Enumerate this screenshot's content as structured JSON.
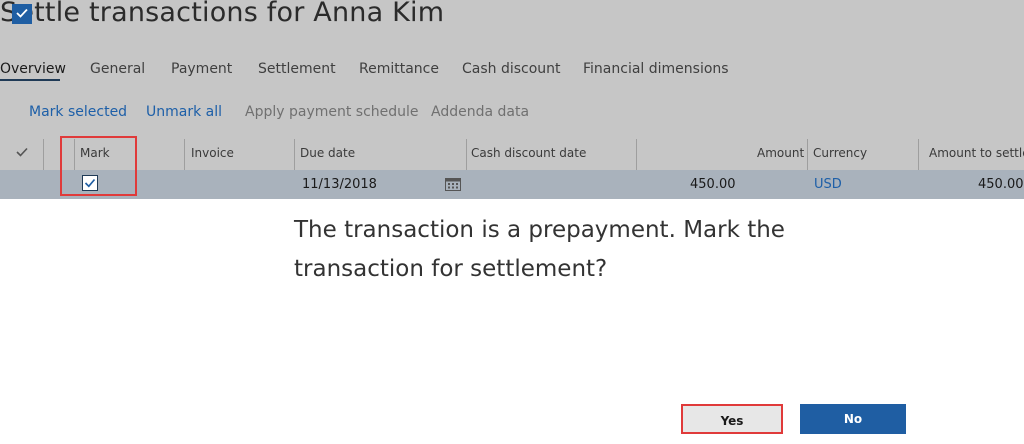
{
  "page": {
    "title": "Settle transactions for Anna Kim"
  },
  "tabs": [
    {
      "label": "Overview"
    },
    {
      "label": "General"
    },
    {
      "label": "Payment"
    },
    {
      "label": "Settlement"
    },
    {
      "label": "Remittance"
    },
    {
      "label": "Cash discount"
    },
    {
      "label": "Financial dimensions"
    }
  ],
  "actions": {
    "mark_selected": "Mark selected",
    "unmark_all": "Unmark all",
    "apply_payment_schedule": "Apply payment schedule",
    "addenda_data": "Addenda data"
  },
  "grid": {
    "columns": {
      "mark": "Mark",
      "invoice": "Invoice",
      "due_date": "Due date",
      "cash_discount_date": "Cash discount date",
      "amount": "Amount",
      "currency": "Currency",
      "amount_to_settle": "Amount to settle"
    },
    "rows": [
      {
        "marked": true,
        "invoice": "",
        "due_date": "11/13/2018",
        "cash_discount_date": "",
        "amount": "450.00",
        "currency": "USD",
        "amount_to_settle": "450.00"
      }
    ]
  },
  "dialog": {
    "message": "The transaction is a prepayment. Mark the transaction for settlement?",
    "yes_label": "Yes",
    "no_label": "No"
  },
  "colors": {
    "accent": "#1f5ea3",
    "highlight_outline": "#e03a3a",
    "overlay": "#c6c6c6"
  },
  "icons": [
    "checkmark-icon",
    "calendar-icon"
  ]
}
